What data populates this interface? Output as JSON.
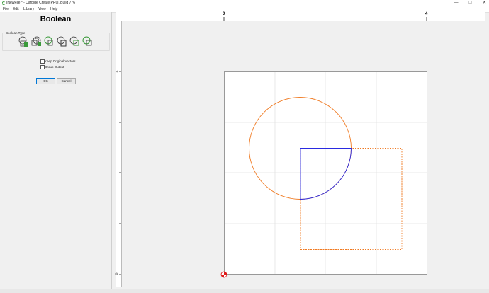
{
  "window": {
    "title": "[NewFile]* - Carbide Create PRO, Build 776",
    "minimize_glyph": "—",
    "maximize_glyph": "□",
    "close_glyph": "✕"
  },
  "menu": [
    "File",
    "Edit",
    "Library",
    "View",
    "Help"
  ],
  "panel": {
    "title": "Boolean",
    "boolean_type_label": "Boolean Type",
    "options": [
      {
        "icon": "union-icon"
      },
      {
        "icon": "union-outline-icon"
      },
      {
        "icon": "subtract-icon"
      },
      {
        "icon": "subtract-reverse-icon"
      },
      {
        "icon": "intersect-icon"
      },
      {
        "icon": "intersect-reverse-icon"
      }
    ],
    "keep_original_label": "Keep Original Vectors",
    "keep_original_checked": false,
    "group_output_label": "Group Output",
    "group_output_checked": false,
    "ok_label": "OK",
    "cancel_label": "Cancel"
  },
  "rulers": {
    "top": [
      "0",
      "4"
    ],
    "left": [
      "4",
      "0"
    ]
  },
  "colors": {
    "accent_green": "#3a9a3a",
    "selection_orange": "#f07a22",
    "result_blue": "#2a2ae0",
    "origin_red": "#e01a1a"
  }
}
